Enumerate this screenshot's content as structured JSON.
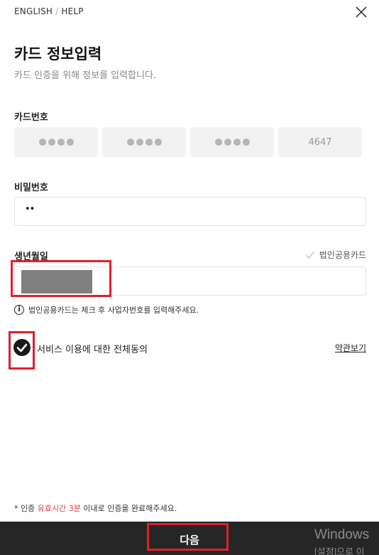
{
  "topbar": {
    "english": "ENGLISH",
    "separator": "/",
    "help": "HELP"
  },
  "header": {
    "title": "카드 정보입력",
    "subtitle": "카드 인증을 위해 정보를 입력합니다."
  },
  "card_number": {
    "label": "카드번호",
    "last_group": "4647"
  },
  "password": {
    "label": "비밀번호",
    "value": "••"
  },
  "birthdate": {
    "label": "생년월일",
    "corp_card_label": "법인공용카드"
  },
  "info": {
    "text": "법인공용카드는 체크 후 사업자번호를 입력해주세요."
  },
  "agreement": {
    "label": "서비스 이용에 대한 전체동의",
    "terms_link": "약관보기",
    "checked": true
  },
  "notice": {
    "prefix": "* 인증 ",
    "highlight": "유효시간 3분",
    "suffix": " 이내로 인증을 완료해주세요."
  },
  "footer": {
    "next_label": "다음"
  },
  "watermark": {
    "line1": "Windows",
    "line2": "[설정]으로 이"
  },
  "colors": {
    "accent_red": "#e0202a",
    "bottom_bar": "#262626",
    "highlight": "#e04040"
  }
}
